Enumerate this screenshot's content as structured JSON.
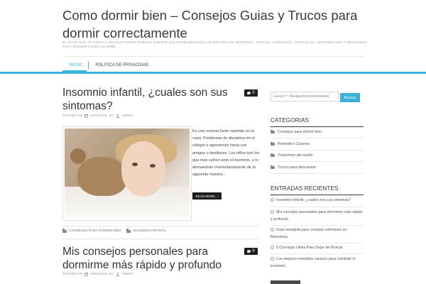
{
  "site": {
    "title": "Como dormir bien – Consejos Guias y Trucos para dormir correctamente",
    "description": "EL SITIO QUE TE EXPLICA DE QUE FORMA PUEDES DORMIR SIN PROBLEMAS EN LAS NOCHES DE INSOMNIO, TRUCOS, CONSEJOS, ARTICULOS, INFORMACION Y RECURSOS PARA DORMIR COMO UN BEBE"
  },
  "nav": {
    "items": [
      {
        "label": "INICIO",
        "active": true
      },
      {
        "label": "POLITICA DE PRIVACIDAD",
        "active": false
      }
    ]
  },
  "posts": [
    {
      "title": "Insomnio infantil, ¿cuales son sus sintomas?",
      "comments": "0",
      "posted_on_label": "POSTED ON",
      "date": "04/10/2011",
      "by_label": "BY",
      "author": "ADMIN",
      "excerpt": "Es una escena harto repetida en tu casa. Problemas de disciplina en el colegio o agresiones hacia sus amigos o familiares. Los niños son los que más sufren ante el insomnio, y lo demuestran involuntariamente de la siguiente manera :",
      "read_more": "READ MORE",
      "tags": [
        "CONSEJOS PARA DORMIR BIEN",
        "INSOMNIO INFANTIL"
      ]
    },
    {
      "title": "Mis consejos personales para dormirme más rápido y profundo",
      "comments": "0",
      "posted_on_label": "POSTED ON",
      "date": "29/09/2011",
      "by_label": "BY",
      "author": "ADMIN"
    }
  ],
  "search": {
    "google_label": "Google™",
    "placeholder": "Búsqueda personalizada",
    "button": "Buscar"
  },
  "categories": {
    "title": "CATEGORIAS",
    "items": [
      "Consejos para dormir bien",
      "Remedios Caseros",
      "Trastornos del sueño",
      "Trucos para descansar"
    ]
  },
  "recent": {
    "title": "ENTRADAS RECIENTES",
    "items": [
      "Insomnio infantil, ¿cuales son sus sintomas?",
      "Mis consejos personales para dormirme más rápido y profundo",
      "Guia completa para comprar colchones en Barcelona",
      "9 Consejos Utiles Para Dejar de Roncar",
      "Los mejores remedios caseros para combatir el insomnio"
    ]
  },
  "colors": {
    "accent": "#3db1d9",
    "dark": "#1e1e1e"
  }
}
